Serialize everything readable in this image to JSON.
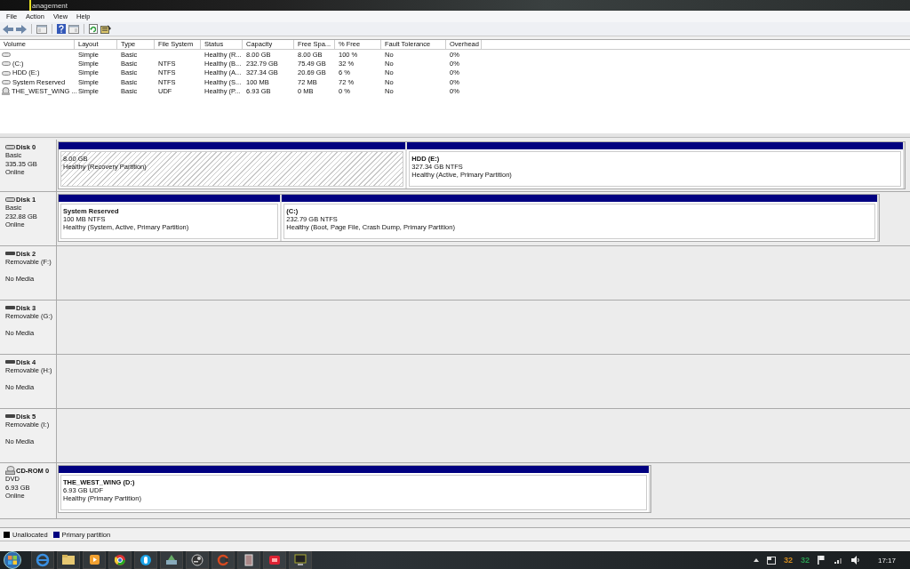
{
  "window": {
    "title": "anagement"
  },
  "menu": [
    "File",
    "Action",
    "View",
    "Help"
  ],
  "volume_table": {
    "columns": [
      "Volume",
      "Layout",
      "Type",
      "File System",
      "Status",
      "Capacity",
      "Free Spa...",
      "% Free",
      "Fault Tolerance",
      "Overhead"
    ],
    "rows": [
      {
        "kind": "drive",
        "cells": [
          "",
          "Simple",
          "Basic",
          "",
          "Healthy (R...",
          "8.00 GB",
          "8.00 GB",
          "100 %",
          "No",
          "0%"
        ]
      },
      {
        "kind": "drive",
        "cells": [
          "(C:)",
          "Simple",
          "Basic",
          "NTFS",
          "Healthy (B...",
          "232.79 GB",
          "75.49 GB",
          "32 %",
          "No",
          "0%"
        ]
      },
      {
        "kind": "drive",
        "cells": [
          "HDD (E:)",
          "Simple",
          "Basic",
          "NTFS",
          "Healthy (A...",
          "327.34 GB",
          "20.69 GB",
          "6 %",
          "No",
          "0%"
        ]
      },
      {
        "kind": "drive",
        "cells": [
          "System Reserved",
          "Simple",
          "Basic",
          "NTFS",
          "Healthy (S...",
          "100 MB",
          "72 MB",
          "72 %",
          "No",
          "0%"
        ]
      },
      {
        "kind": "disc",
        "cells": [
          "THE_WEST_WING ...",
          "Simple",
          "Basic",
          "UDF",
          "Healthy (P...",
          "6.93 GB",
          "0 MB",
          "0 %",
          "No",
          "0%"
        ]
      }
    ]
  },
  "disks": [
    {
      "kind": "disk",
      "name": "Disk 0",
      "type": "Basic",
      "size": "335.35 GB",
      "status": "Online",
      "partitions": [
        {
          "kind": "recovery",
          "size": "8.00 GB",
          "status": "Healthy (Recovery Partition)"
        },
        {
          "kind": "primary",
          "title": "HDD  (E:)",
          "size": "327.34 GB NTFS",
          "status": "Healthy (Active, Primary Partition)"
        }
      ]
    },
    {
      "kind": "disk",
      "name": "Disk 1",
      "type": "Basic",
      "size": "232.88 GB",
      "status": "Online",
      "partitions": [
        {
          "kind": "primary",
          "title": "System Reserved",
          "size": "100 MB NTFS",
          "status": "Healthy (System, Active, Primary Partition)"
        },
        {
          "kind": "primary",
          "title": "(C:)",
          "size": "232.79 GB NTFS",
          "status": "Healthy (Boot, Page File, Crash Dump, Primary Partition)"
        }
      ]
    },
    {
      "kind": "removable",
      "name": "Disk 2",
      "type": "Removable (F:)",
      "status": "No Media"
    },
    {
      "kind": "removable",
      "name": "Disk 3",
      "type": "Removable (G:)",
      "status": "No Media"
    },
    {
      "kind": "removable",
      "name": "Disk 4",
      "type": "Removable (H:)",
      "status": "No Media"
    },
    {
      "kind": "removable",
      "name": "Disk 5",
      "type": "Removable (I:)",
      "status": "No Media"
    },
    {
      "kind": "cdrom",
      "name": "CD-ROM 0",
      "type": "DVD",
      "size": "6.93 GB",
      "status": "Online",
      "partitions": [
        {
          "kind": "primary",
          "title": "THE_WEST_WING  (D:)",
          "size": "6.93 GB UDF",
          "status": "Healthy (Primary Partition)"
        }
      ]
    }
  ],
  "legend": [
    {
      "label": "Unallocated",
      "color": "#000000"
    },
    {
      "label": "Primary partition",
      "color": "#000080"
    }
  ],
  "tray": {
    "counters": [
      {
        "text": "32",
        "color": "#d08a20"
      },
      {
        "text": "32",
        "color": "#2a9a50"
      }
    ],
    "clock": "17:17"
  }
}
